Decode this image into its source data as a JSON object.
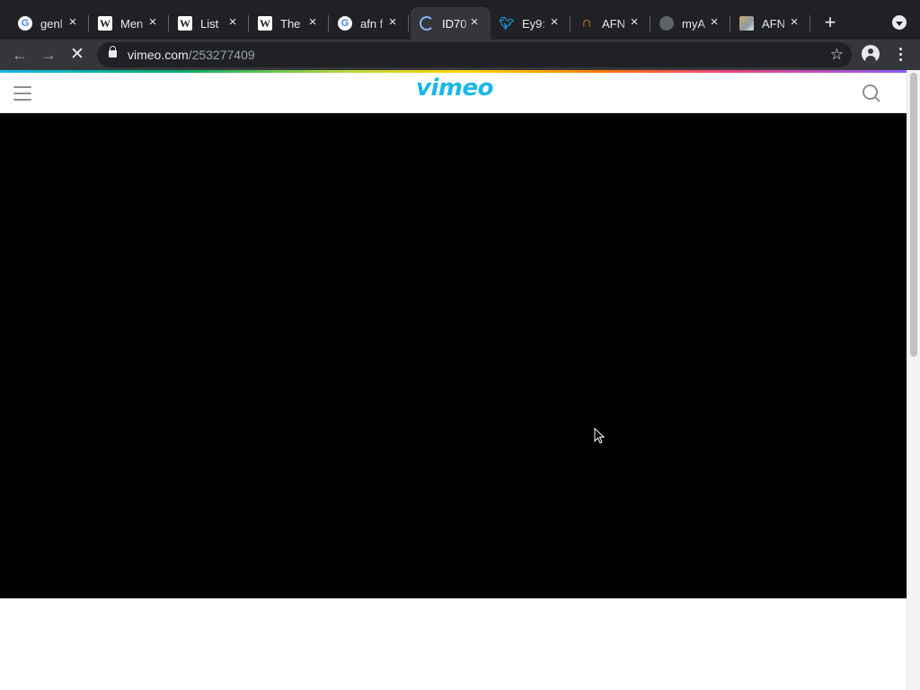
{
  "browser": {
    "tabs": [
      {
        "title": "genl",
        "favicon": "google-icon",
        "active": false
      },
      {
        "title": "Men",
        "favicon": "wikipedia-icon",
        "active": false
      },
      {
        "title": "List",
        "favicon": "wikipedia-icon",
        "active": false
      },
      {
        "title": "The",
        "favicon": "wikipedia-icon",
        "active": false
      },
      {
        "title": "afn f",
        "favicon": "google-icon",
        "active": false
      },
      {
        "title": "ID70",
        "favicon": "loading-spinner-icon",
        "active": true
      },
      {
        "title": "Ey9:",
        "favicon": "twitter-icon",
        "active": false
      },
      {
        "title": "AFN",
        "favicon": "archive-arch-icon",
        "active": false
      },
      {
        "title": "myA",
        "favicon": "globe-icon",
        "active": false
      },
      {
        "title": "AFN",
        "favicon": "image-icon",
        "active": false
      }
    ],
    "tab_close_glyph": "×",
    "new_tab_glyph": "+",
    "url": {
      "domain": "vimeo.com",
      "path": "/253277409"
    },
    "nav": {
      "back": "←",
      "forward": "→",
      "stop": "✕",
      "bookmark": "☆"
    }
  },
  "page": {
    "logo_text": "vimeo",
    "brand_color": "#1ab7ea",
    "player_color": "#000000"
  }
}
